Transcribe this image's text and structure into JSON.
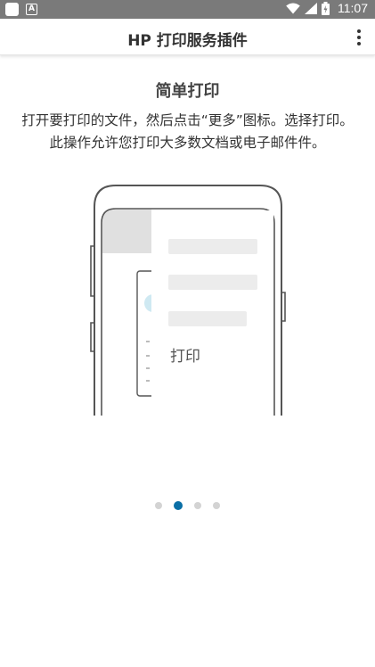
{
  "statusbar": {
    "time": "11:07"
  },
  "toolbar": {
    "title": "HP 打印服务插件"
  },
  "onboarding": {
    "heading": "简单打印",
    "description": "打开要打印的文件，然后点击“更多”图标。选择打印。此操作允许您打印大多数文档或电子邮件件。",
    "illustration": {
      "menu_print_label": "打印"
    },
    "page_indicator": {
      "total": 4,
      "current": 2
    }
  },
  "colors": {
    "accent": "#0a6fa6",
    "statusbar": "#7a7a7a"
  },
  "icons": [
    "app-notification-icon",
    "a-notification-icon",
    "wifi-icon",
    "signal-icon",
    "battery-icon",
    "more-options-icon"
  ]
}
